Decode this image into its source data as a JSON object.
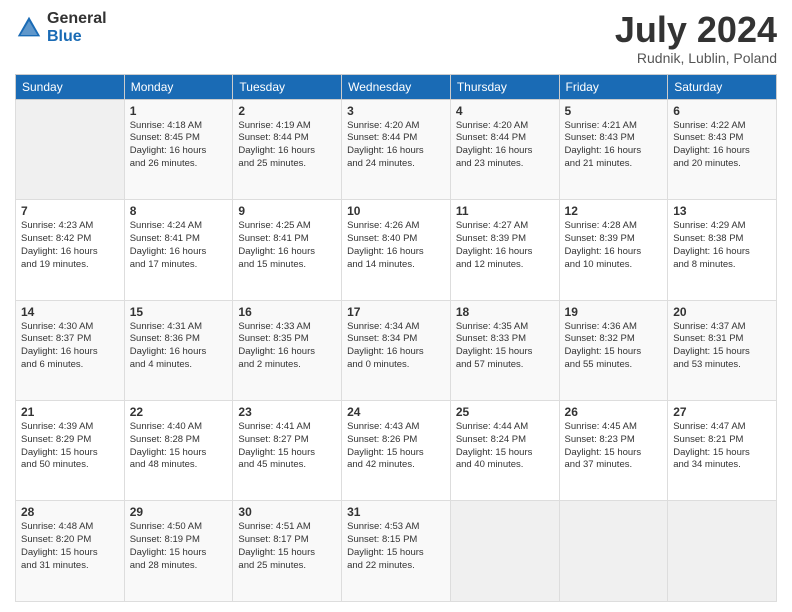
{
  "logo": {
    "general": "General",
    "blue": "Blue"
  },
  "title": "July 2024",
  "location": "Rudnik, Lublin, Poland",
  "days_of_week": [
    "Sunday",
    "Monday",
    "Tuesday",
    "Wednesday",
    "Thursday",
    "Friday",
    "Saturday"
  ],
  "weeks": [
    [
      {
        "day": "",
        "info": ""
      },
      {
        "day": "1",
        "info": "Sunrise: 4:18 AM\nSunset: 8:45 PM\nDaylight: 16 hours\nand 26 minutes."
      },
      {
        "day": "2",
        "info": "Sunrise: 4:19 AM\nSunset: 8:44 PM\nDaylight: 16 hours\nand 25 minutes."
      },
      {
        "day": "3",
        "info": "Sunrise: 4:20 AM\nSunset: 8:44 PM\nDaylight: 16 hours\nand 24 minutes."
      },
      {
        "day": "4",
        "info": "Sunrise: 4:20 AM\nSunset: 8:44 PM\nDaylight: 16 hours\nand 23 minutes."
      },
      {
        "day": "5",
        "info": "Sunrise: 4:21 AM\nSunset: 8:43 PM\nDaylight: 16 hours\nand 21 minutes."
      },
      {
        "day": "6",
        "info": "Sunrise: 4:22 AM\nSunset: 8:43 PM\nDaylight: 16 hours\nand 20 minutes."
      }
    ],
    [
      {
        "day": "7",
        "info": "Sunrise: 4:23 AM\nSunset: 8:42 PM\nDaylight: 16 hours\nand 19 minutes."
      },
      {
        "day": "8",
        "info": "Sunrise: 4:24 AM\nSunset: 8:41 PM\nDaylight: 16 hours\nand 17 minutes."
      },
      {
        "day": "9",
        "info": "Sunrise: 4:25 AM\nSunset: 8:41 PM\nDaylight: 16 hours\nand 15 minutes."
      },
      {
        "day": "10",
        "info": "Sunrise: 4:26 AM\nSunset: 8:40 PM\nDaylight: 16 hours\nand 14 minutes."
      },
      {
        "day": "11",
        "info": "Sunrise: 4:27 AM\nSunset: 8:39 PM\nDaylight: 16 hours\nand 12 minutes."
      },
      {
        "day": "12",
        "info": "Sunrise: 4:28 AM\nSunset: 8:39 PM\nDaylight: 16 hours\nand 10 minutes."
      },
      {
        "day": "13",
        "info": "Sunrise: 4:29 AM\nSunset: 8:38 PM\nDaylight: 16 hours\nand 8 minutes."
      }
    ],
    [
      {
        "day": "14",
        "info": "Sunrise: 4:30 AM\nSunset: 8:37 PM\nDaylight: 16 hours\nand 6 minutes."
      },
      {
        "day": "15",
        "info": "Sunrise: 4:31 AM\nSunset: 8:36 PM\nDaylight: 16 hours\nand 4 minutes."
      },
      {
        "day": "16",
        "info": "Sunrise: 4:33 AM\nSunset: 8:35 PM\nDaylight: 16 hours\nand 2 minutes."
      },
      {
        "day": "17",
        "info": "Sunrise: 4:34 AM\nSunset: 8:34 PM\nDaylight: 16 hours\nand 0 minutes."
      },
      {
        "day": "18",
        "info": "Sunrise: 4:35 AM\nSunset: 8:33 PM\nDaylight: 15 hours\nand 57 minutes."
      },
      {
        "day": "19",
        "info": "Sunrise: 4:36 AM\nSunset: 8:32 PM\nDaylight: 15 hours\nand 55 minutes."
      },
      {
        "day": "20",
        "info": "Sunrise: 4:37 AM\nSunset: 8:31 PM\nDaylight: 15 hours\nand 53 minutes."
      }
    ],
    [
      {
        "day": "21",
        "info": "Sunrise: 4:39 AM\nSunset: 8:29 PM\nDaylight: 15 hours\nand 50 minutes."
      },
      {
        "day": "22",
        "info": "Sunrise: 4:40 AM\nSunset: 8:28 PM\nDaylight: 15 hours\nand 48 minutes."
      },
      {
        "day": "23",
        "info": "Sunrise: 4:41 AM\nSunset: 8:27 PM\nDaylight: 15 hours\nand 45 minutes."
      },
      {
        "day": "24",
        "info": "Sunrise: 4:43 AM\nSunset: 8:26 PM\nDaylight: 15 hours\nand 42 minutes."
      },
      {
        "day": "25",
        "info": "Sunrise: 4:44 AM\nSunset: 8:24 PM\nDaylight: 15 hours\nand 40 minutes."
      },
      {
        "day": "26",
        "info": "Sunrise: 4:45 AM\nSunset: 8:23 PM\nDaylight: 15 hours\nand 37 minutes."
      },
      {
        "day": "27",
        "info": "Sunrise: 4:47 AM\nSunset: 8:21 PM\nDaylight: 15 hours\nand 34 minutes."
      }
    ],
    [
      {
        "day": "28",
        "info": "Sunrise: 4:48 AM\nSunset: 8:20 PM\nDaylight: 15 hours\nand 31 minutes."
      },
      {
        "day": "29",
        "info": "Sunrise: 4:50 AM\nSunset: 8:19 PM\nDaylight: 15 hours\nand 28 minutes."
      },
      {
        "day": "30",
        "info": "Sunrise: 4:51 AM\nSunset: 8:17 PM\nDaylight: 15 hours\nand 25 minutes."
      },
      {
        "day": "31",
        "info": "Sunrise: 4:53 AM\nSunset: 8:15 PM\nDaylight: 15 hours\nand 22 minutes."
      },
      {
        "day": "",
        "info": ""
      },
      {
        "day": "",
        "info": ""
      },
      {
        "day": "",
        "info": ""
      }
    ]
  ]
}
